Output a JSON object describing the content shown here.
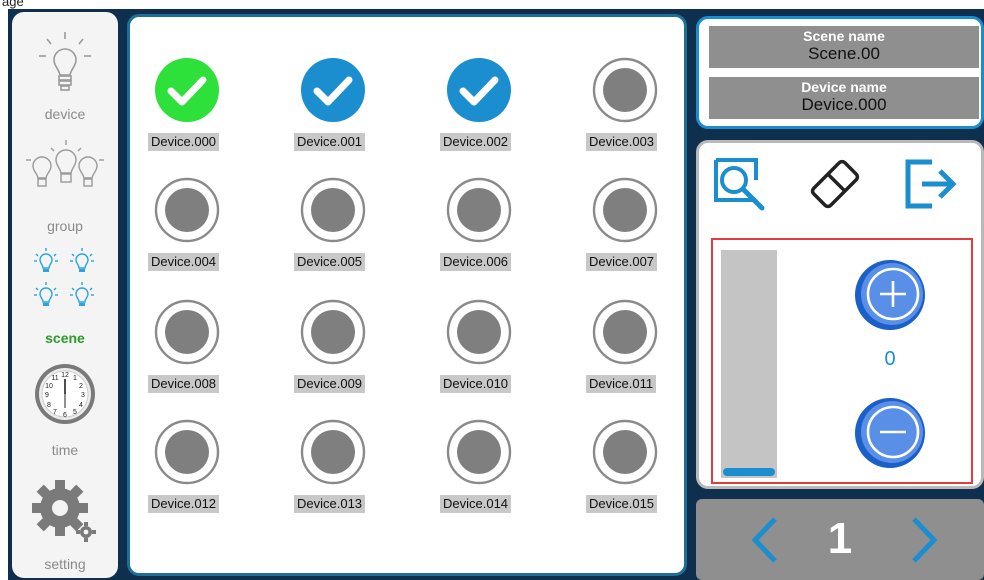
{
  "header": {
    "fragment": "age"
  },
  "sidebar": {
    "items": [
      {
        "label": "device"
      },
      {
        "label": "group"
      },
      {
        "label": "scene"
      },
      {
        "label": "time"
      },
      {
        "label": "setting"
      }
    ],
    "active": "scene"
  },
  "devices": [
    {
      "name": "Device.000",
      "state": "selected-green"
    },
    {
      "name": "Device.001",
      "state": "selected-blue"
    },
    {
      "name": "Device.002",
      "state": "selected-blue"
    },
    {
      "name": "Device.003",
      "state": "unselected"
    },
    {
      "name": "Device.004",
      "state": "unselected"
    },
    {
      "name": "Device.005",
      "state": "unselected"
    },
    {
      "name": "Device.006",
      "state": "unselected"
    },
    {
      "name": "Device.007",
      "state": "unselected"
    },
    {
      "name": "Device.008",
      "state": "unselected"
    },
    {
      "name": "Device.009",
      "state": "unselected"
    },
    {
      "name": "Device.010",
      "state": "unselected"
    },
    {
      "name": "Device.011",
      "state": "unselected"
    },
    {
      "name": "Device.012",
      "state": "unselected"
    },
    {
      "name": "Device.013",
      "state": "unselected"
    },
    {
      "name": "Device.014",
      "state": "unselected"
    },
    {
      "name": "Device.015",
      "state": "unselected"
    }
  ],
  "info": {
    "scene_title": "Scene name",
    "scene_value": "Scene.00",
    "device_title": "Device name",
    "device_value": "Device.000"
  },
  "tools": {
    "icons": [
      "search-icon",
      "eraser-icon",
      "exit-icon"
    ]
  },
  "adjust": {
    "value": "0",
    "level": 0
  },
  "pager": {
    "page": "1"
  },
  "colors": {
    "accent": "#1b8ecf",
    "selected_green": "#2ee03a",
    "frame_dark": "#1e6f95",
    "highlight_red": "#e23c3c"
  }
}
